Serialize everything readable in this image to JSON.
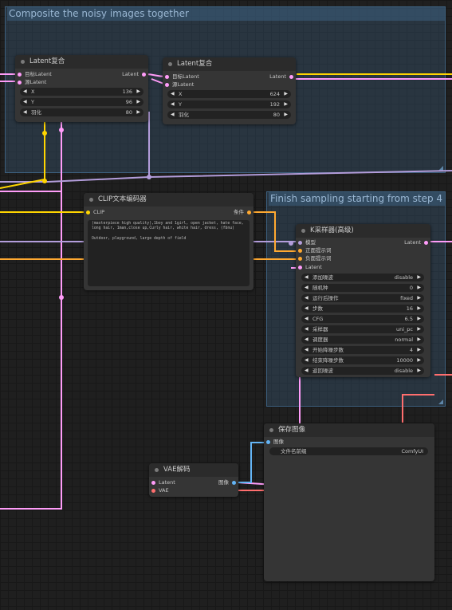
{
  "groups": {
    "composite": {
      "title": "Composite the noisy images together"
    },
    "finish": {
      "title": "Finish sampling starting from step 4"
    }
  },
  "latent_composite_1": {
    "title": "Latent复合",
    "inputs": [
      "目标Latent",
      "源Latent"
    ],
    "output": "Latent",
    "widgets": [
      {
        "label": "X",
        "value": "136"
      },
      {
        "label": "Y",
        "value": "96"
      },
      {
        "label": "羽化",
        "value": "80"
      }
    ]
  },
  "latent_composite_2": {
    "title": "Latent复合",
    "inputs": [
      "目标Latent",
      "源Latent"
    ],
    "output": "Latent",
    "widgets": [
      {
        "label": "X",
        "value": "624"
      },
      {
        "label": "Y",
        "value": "192"
      },
      {
        "label": "羽化",
        "value": "80"
      }
    ]
  },
  "clip_encode": {
    "title": "CLIP文本编码器",
    "input": "CLIP",
    "output": "条件",
    "text": "(masterpiece high quality),1boy and 1girl, open jacket, hate face, long hair, 1man,close up,Curly hair, white hair, dress, (fbnu)\n\nOutdoor, playground, large depth of field"
  },
  "ksampler": {
    "title": "K采样器(高级)",
    "inputs": [
      "模型",
      "正面提示词",
      "负面提示词",
      "Latent"
    ],
    "output": "Latent",
    "widgets": [
      {
        "label": "添加噪波",
        "value": "disable"
      },
      {
        "label": "随机种",
        "value": "0"
      },
      {
        "label": "运行后操作",
        "value": "fixed"
      },
      {
        "label": "步数",
        "value": "16"
      },
      {
        "label": "CFG",
        "value": "6.5"
      },
      {
        "label": "采样器",
        "value": "uni_pc"
      },
      {
        "label": "调度器",
        "value": "normal"
      },
      {
        "label": "开始降噪步数",
        "value": "4"
      },
      {
        "label": "结束降噪步数",
        "value": "10000"
      },
      {
        "label": "返回噪波",
        "value": "disable"
      }
    ]
  },
  "vae_decode": {
    "title": "VAE解码",
    "inputs": [
      "Latent",
      "VAE"
    ],
    "output": "图像"
  },
  "save_image": {
    "title": "保存图像",
    "input": "图像",
    "widget": {
      "label": "文件名前缀",
      "value": "ComfyUI"
    }
  },
  "colors": {
    "latent": "#ff9cf9",
    "model": "#b39ddb",
    "conditioning": "#ffa931",
    "clip": "#ffd500",
    "vae": "#ff6e6e",
    "image": "#64b5f6"
  }
}
